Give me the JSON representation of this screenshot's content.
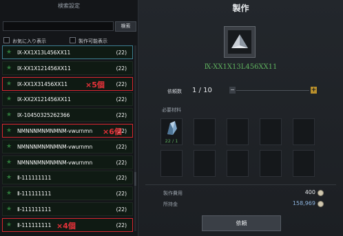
{
  "search": {
    "title": "検索設定",
    "input_value": "",
    "button_label": "検索",
    "favorites_label": "お気に入り表示",
    "craftable_label": "製作可能表示"
  },
  "recipes": [
    {
      "name": "Ⅸ-XX1X13L456XX11",
      "count": "(22)",
      "selected": true,
      "annotation": ""
    },
    {
      "name": "Ⅸ-XX1X121456XX11",
      "count": "(22)",
      "selected": false,
      "annotation": ""
    },
    {
      "name": "Ⅸ-XX1X31456XX11",
      "count": "(22)",
      "selected": false,
      "annotation": "×5個"
    },
    {
      "name": "Ⅸ-XX2X121456XX11",
      "count": "(22)",
      "selected": false,
      "annotation": ""
    },
    {
      "name": "Ⅸ-10450325262366",
      "count": "(22)",
      "selected": false,
      "annotation": ""
    },
    {
      "name": "NMNNNMNMNMNM-vwurnmn",
      "count": "(22)",
      "selected": false,
      "annotation": "×6個"
    },
    {
      "name": "NMNNNMNMNMNM-vwurnmn",
      "count": "(22)",
      "selected": false,
      "annotation": ""
    },
    {
      "name": "NMNNNMNMNMNM-vwurnmn",
      "count": "(22)",
      "selected": false,
      "annotation": ""
    },
    {
      "name": "Ⅱ-111111111",
      "count": "(22)",
      "selected": false,
      "annotation": ""
    },
    {
      "name": "Ⅱ-111111111",
      "count": "(22)",
      "selected": false,
      "annotation": ""
    },
    {
      "name": "Ⅱ-111111111",
      "count": "(22)",
      "selected": false,
      "annotation": ""
    },
    {
      "name": "Ⅱ-111111111",
      "count": "(22)",
      "selected": false,
      "annotation": "×4個"
    }
  ],
  "detail": {
    "title": "製作",
    "item_name": "Ⅸ-XX1X13L456XX11",
    "request_label": "依頼数",
    "request_value": "1 / 10",
    "minus_label": "−",
    "plus_label": "+",
    "materials_label": "必要材料",
    "material_count": "22 / 1",
    "cost_label": "製作費用",
    "cost_value": "400",
    "holdings_label": "所持金",
    "holdings_value": "158,969",
    "craft_button": "依頼"
  },
  "colors": {
    "highlight_border": "#d9262f",
    "item_name_green": "#5fb35f",
    "plus_gold": "#b9902c"
  }
}
